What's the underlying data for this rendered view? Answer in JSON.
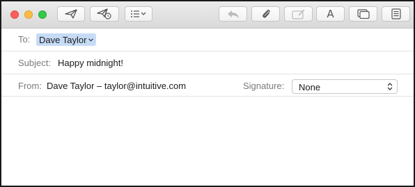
{
  "window": {
    "traffic_lights": {
      "close_color": "#fc605c",
      "minimize_color": "#fdbc40",
      "maximize_color": "#34c84a"
    }
  },
  "toolbar": {
    "buttons": [
      {
        "icon": "paper-plane-send-icon",
        "enabled": true
      },
      {
        "icon": "send-later-icon",
        "enabled": true
      },
      {
        "icon": "list-format-dropdown-icon",
        "enabled": true
      },
      {
        "icon": "reply-arrow-icon",
        "enabled": false
      },
      {
        "icon": "paperclip-attach-icon",
        "enabled": true
      },
      {
        "icon": "markup-photo-icon",
        "enabled": false
      },
      {
        "icon": "fonts-icon",
        "label": "A",
        "enabled": true
      },
      {
        "icon": "show-browser-windows-icon",
        "enabled": true
      },
      {
        "icon": "photo-browser-icon",
        "enabled": true
      }
    ]
  },
  "compose": {
    "to_label": "To:",
    "to_recipient": "Dave Taylor",
    "subject_label": "Subject:",
    "subject_value": "Happy midnight!",
    "from_label": "From:",
    "from_value": "Dave Taylor – taylor@intuitive.com",
    "signature_label": "Signature:",
    "signature_value": "None",
    "token_color": "#c6dcf6"
  },
  "body": {
    "text": ""
  }
}
